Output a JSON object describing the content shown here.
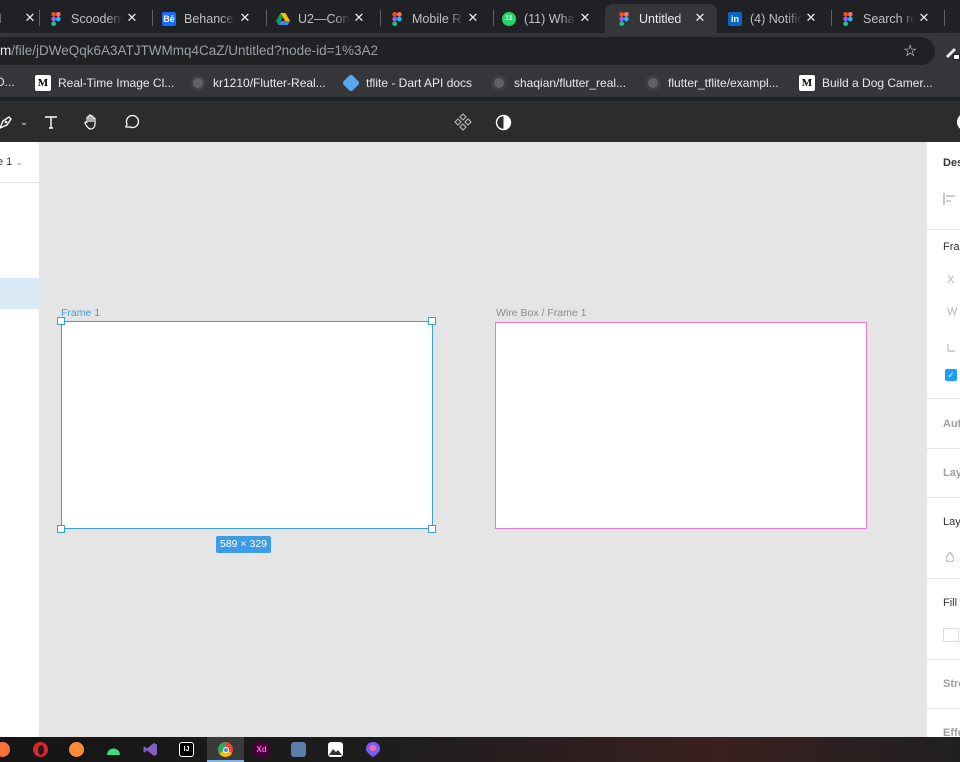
{
  "browser": {
    "tabs": [
      {
        "title": "nl",
        "favicon": "figma-icon",
        "active": false
      },
      {
        "title": "Scoodent",
        "favicon": "figma-icon",
        "active": false
      },
      {
        "title": "Behance",
        "favicon": "behance-icon",
        "active": false
      },
      {
        "title": "U2—Con",
        "favicon": "google-drive-icon",
        "active": false
      },
      {
        "title": "Mobile R",
        "favicon": "figma-icon",
        "active": false
      },
      {
        "title": "(11) Wha",
        "favicon": "whatsapp-icon",
        "badge": "11",
        "active": false
      },
      {
        "title": "Untitled",
        "favicon": "figma-icon",
        "active": true
      },
      {
        "title": "(4) Notific",
        "favicon": "linkedin-icon",
        "active": false
      },
      {
        "title": "Search re",
        "favicon": "figma-icon",
        "active": false
      }
    ],
    "close_glyph": "✕",
    "url": {
      "host": "m",
      "path": "/file/jDWeQqk6A3ATJTWMmq4CaZ/Untitled?node-id=1%3A2"
    },
    "bookmarks": [
      {
        "label": "D...",
        "icon": "figma-icon"
      },
      {
        "label": "Real-Time Image Cl...",
        "icon": "medium-icon"
      },
      {
        "label": "kr1210/Flutter-Real...",
        "icon": "github-icon"
      },
      {
        "label": "tflite - Dart API docs",
        "icon": "dart-icon"
      },
      {
        "label": "shaqian/flutter_real...",
        "icon": "github-icon"
      },
      {
        "label": "flutter_tflite/exampl...",
        "icon": "github-icon"
      },
      {
        "label": "Build a Dog Camer...",
        "icon": "medium-icon"
      }
    ]
  },
  "figma": {
    "toolbar_icons": [
      "pen-icon",
      "chevron-down-icon",
      "text-tool-icon",
      "hand-tool-icon",
      "comment-icon",
      "components-icon",
      "contrast-icon"
    ],
    "page_name": "e 1",
    "canvas": {
      "frame1_label": "Frame 1",
      "frame1_size": "589 × 329",
      "frame2_label": "Wire Box / Frame 1"
    },
    "right_panel": {
      "tab": "Des",
      "frame_section": "Fra",
      "x_label": "X",
      "w_label": "W",
      "auto_layout": "Auto",
      "layout_grid": "Lay",
      "layer": "Lay",
      "fill": "Fill",
      "stroke": "Stro",
      "effects": "Effe"
    },
    "colors": {
      "selection": "#3d9ce8",
      "component_stroke": "#e879d0",
      "canvas": "#e5e5e5"
    }
  },
  "taskbar": {
    "apps": [
      "firefox-icon",
      "opera-icon",
      "firefox-dev-icon",
      "android-studio-icon",
      "visual-studio-icon",
      "intellij-icon",
      "chrome-icon",
      "adobe-xd-icon",
      "photos-icon",
      "image-viewer-icon",
      "figma-desktop-icon"
    ],
    "labels": {
      "xd": "Xd",
      "ij": "IJ"
    }
  }
}
